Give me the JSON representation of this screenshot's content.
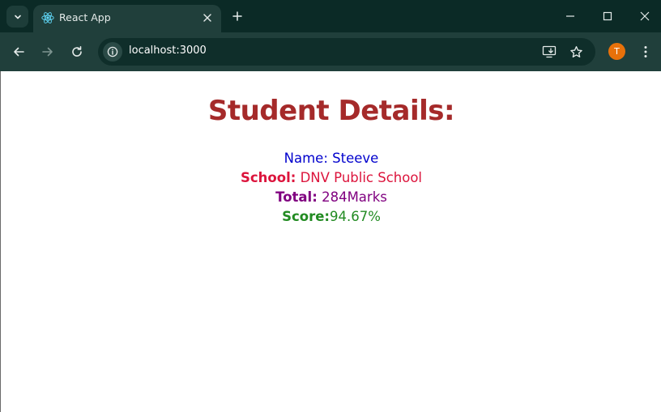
{
  "browser": {
    "tab_title": "React App",
    "url": "localhost:3000",
    "profile_initial": "T"
  },
  "icons": {
    "tab_search": "chevron-down-icon",
    "favicon": "react-logo-icon",
    "tab_close": "close-icon",
    "new_tab": "plus-icon",
    "minimize": "minimize-icon",
    "maximize": "maximize-icon",
    "close_window": "close-icon",
    "back": "arrow-left-icon",
    "forward": "arrow-right-icon",
    "reload": "reload-icon",
    "site_info": "info-icon",
    "install": "install-app-icon",
    "bookmark": "star-icon",
    "menu": "kebab-menu-icon"
  },
  "colors": {
    "title": "#a52a2a",
    "name": "#0000cd",
    "school": "#dc143c",
    "total": "#800080",
    "score": "#228b22",
    "avatar": "#e8710a"
  },
  "page": {
    "title": "Student Details:",
    "name": {
      "label": "Name:",
      "value": "Steeve"
    },
    "school": {
      "label": "School:",
      "value": "DNV Public School"
    },
    "total": {
      "label": "Total:",
      "value": "284Marks"
    },
    "score": {
      "label": "Score:",
      "value": "94.67%"
    }
  }
}
